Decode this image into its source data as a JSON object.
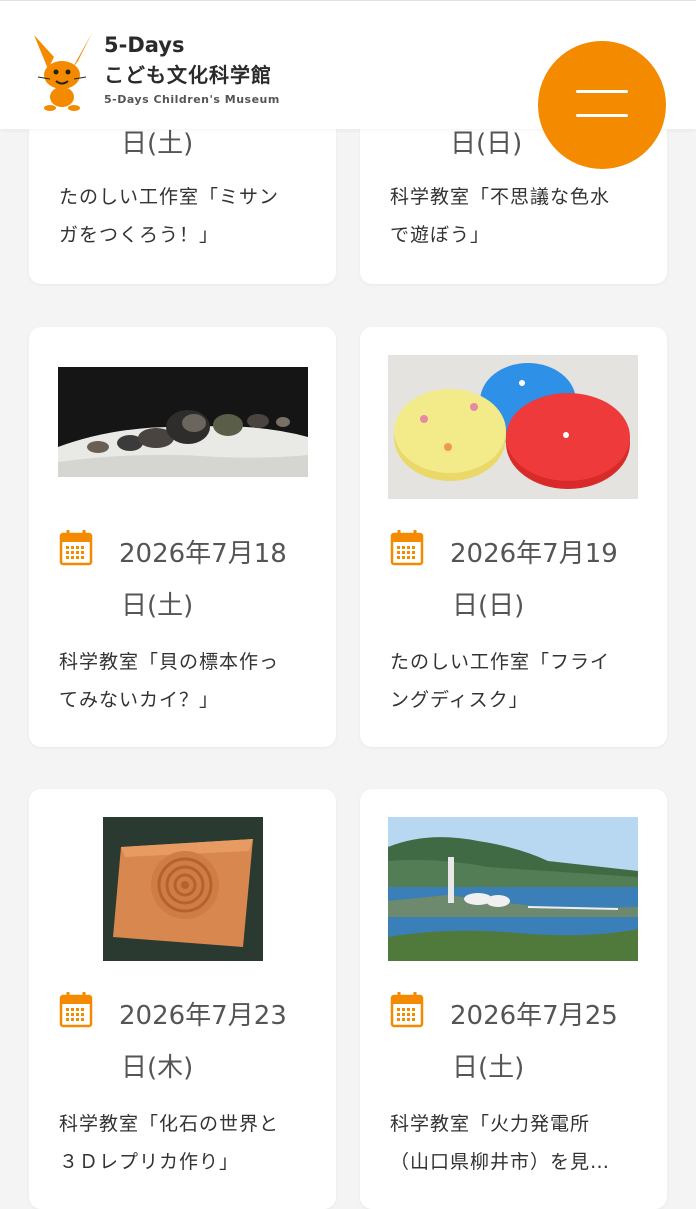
{
  "header": {
    "logo_title": "5-Days",
    "logo_subtitle": "こども文化科学館",
    "logo_english": "5-Days Children's Museum",
    "menu_button": "menu",
    "logo_icon": "rabbit-mascot-icon",
    "accent_color": "#f38a00"
  },
  "cards": [
    {
      "day": "日(土)",
      "title": "たのしい工作室「ミサンガをつくろう！」",
      "title_line1": "たのしい工作室「ミサン",
      "title_line2": "ガをつくろう！」"
    },
    {
      "day": "日(日)",
      "title": "科学教室「不思議な色水で遊ぼう」",
      "title_line1": "科学教室「不思議な色水",
      "title_line2": "で遊ぼう」"
    },
    {
      "date": "2026年7月18",
      "day": "日(土)",
      "title_line1": "科学教室「貝の標本作っ",
      "title_line2": "てみないカイ？」",
      "image": "seashell-specimens-photo"
    },
    {
      "date": "2026年7月19",
      "day": "日(日)",
      "title_line1": "たのしい工作室「フライ",
      "title_line2": "ングディスク」",
      "image": "flying-disk-photo"
    },
    {
      "date": "2026年7月23",
      "day": "日(木)",
      "title_line1": "科学教室「化石の世界と",
      "title_line2": "３Ｄレプリカ作り」",
      "image": "ammonite-fossil-photo"
    },
    {
      "date": "2026年7月25",
      "day": "日(土)",
      "title_line1": "科学教室「火力発電所",
      "title_line2": "（山口県柳井市）を見…",
      "image": "power-plant-photo"
    }
  ]
}
